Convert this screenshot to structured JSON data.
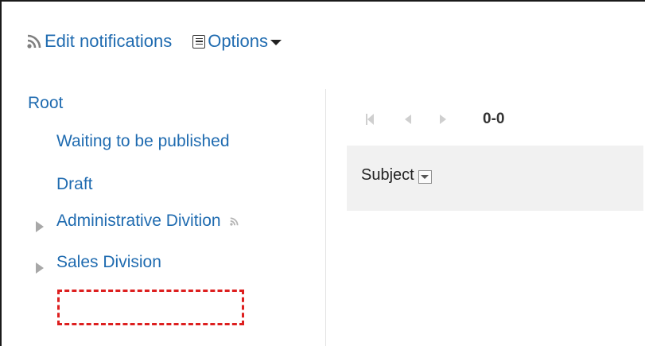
{
  "toolbar": {
    "edit_notifications": {
      "label": "Edit notifications",
      "icon": "rss-icon"
    },
    "options": {
      "label": "Options",
      "icon": "menu-icon"
    }
  },
  "tree": {
    "root": "Root",
    "items": [
      {
        "label": "Waiting to be published",
        "expandable": false
      },
      {
        "label": "Draft",
        "expandable": false
      },
      {
        "label": "Administrative Divition",
        "expandable": true,
        "has_notification_icon": true
      },
      {
        "label": "Sales Division",
        "expandable": true
      }
    ]
  },
  "pager": {
    "range": "0-0"
  },
  "list_header": {
    "subject": "Subject"
  },
  "colors": {
    "link": "#1f6bb0",
    "highlight": "#dd1f1f",
    "header_bg": "#f1f1f1",
    "disabled_icon": "#cfcfcf"
  }
}
